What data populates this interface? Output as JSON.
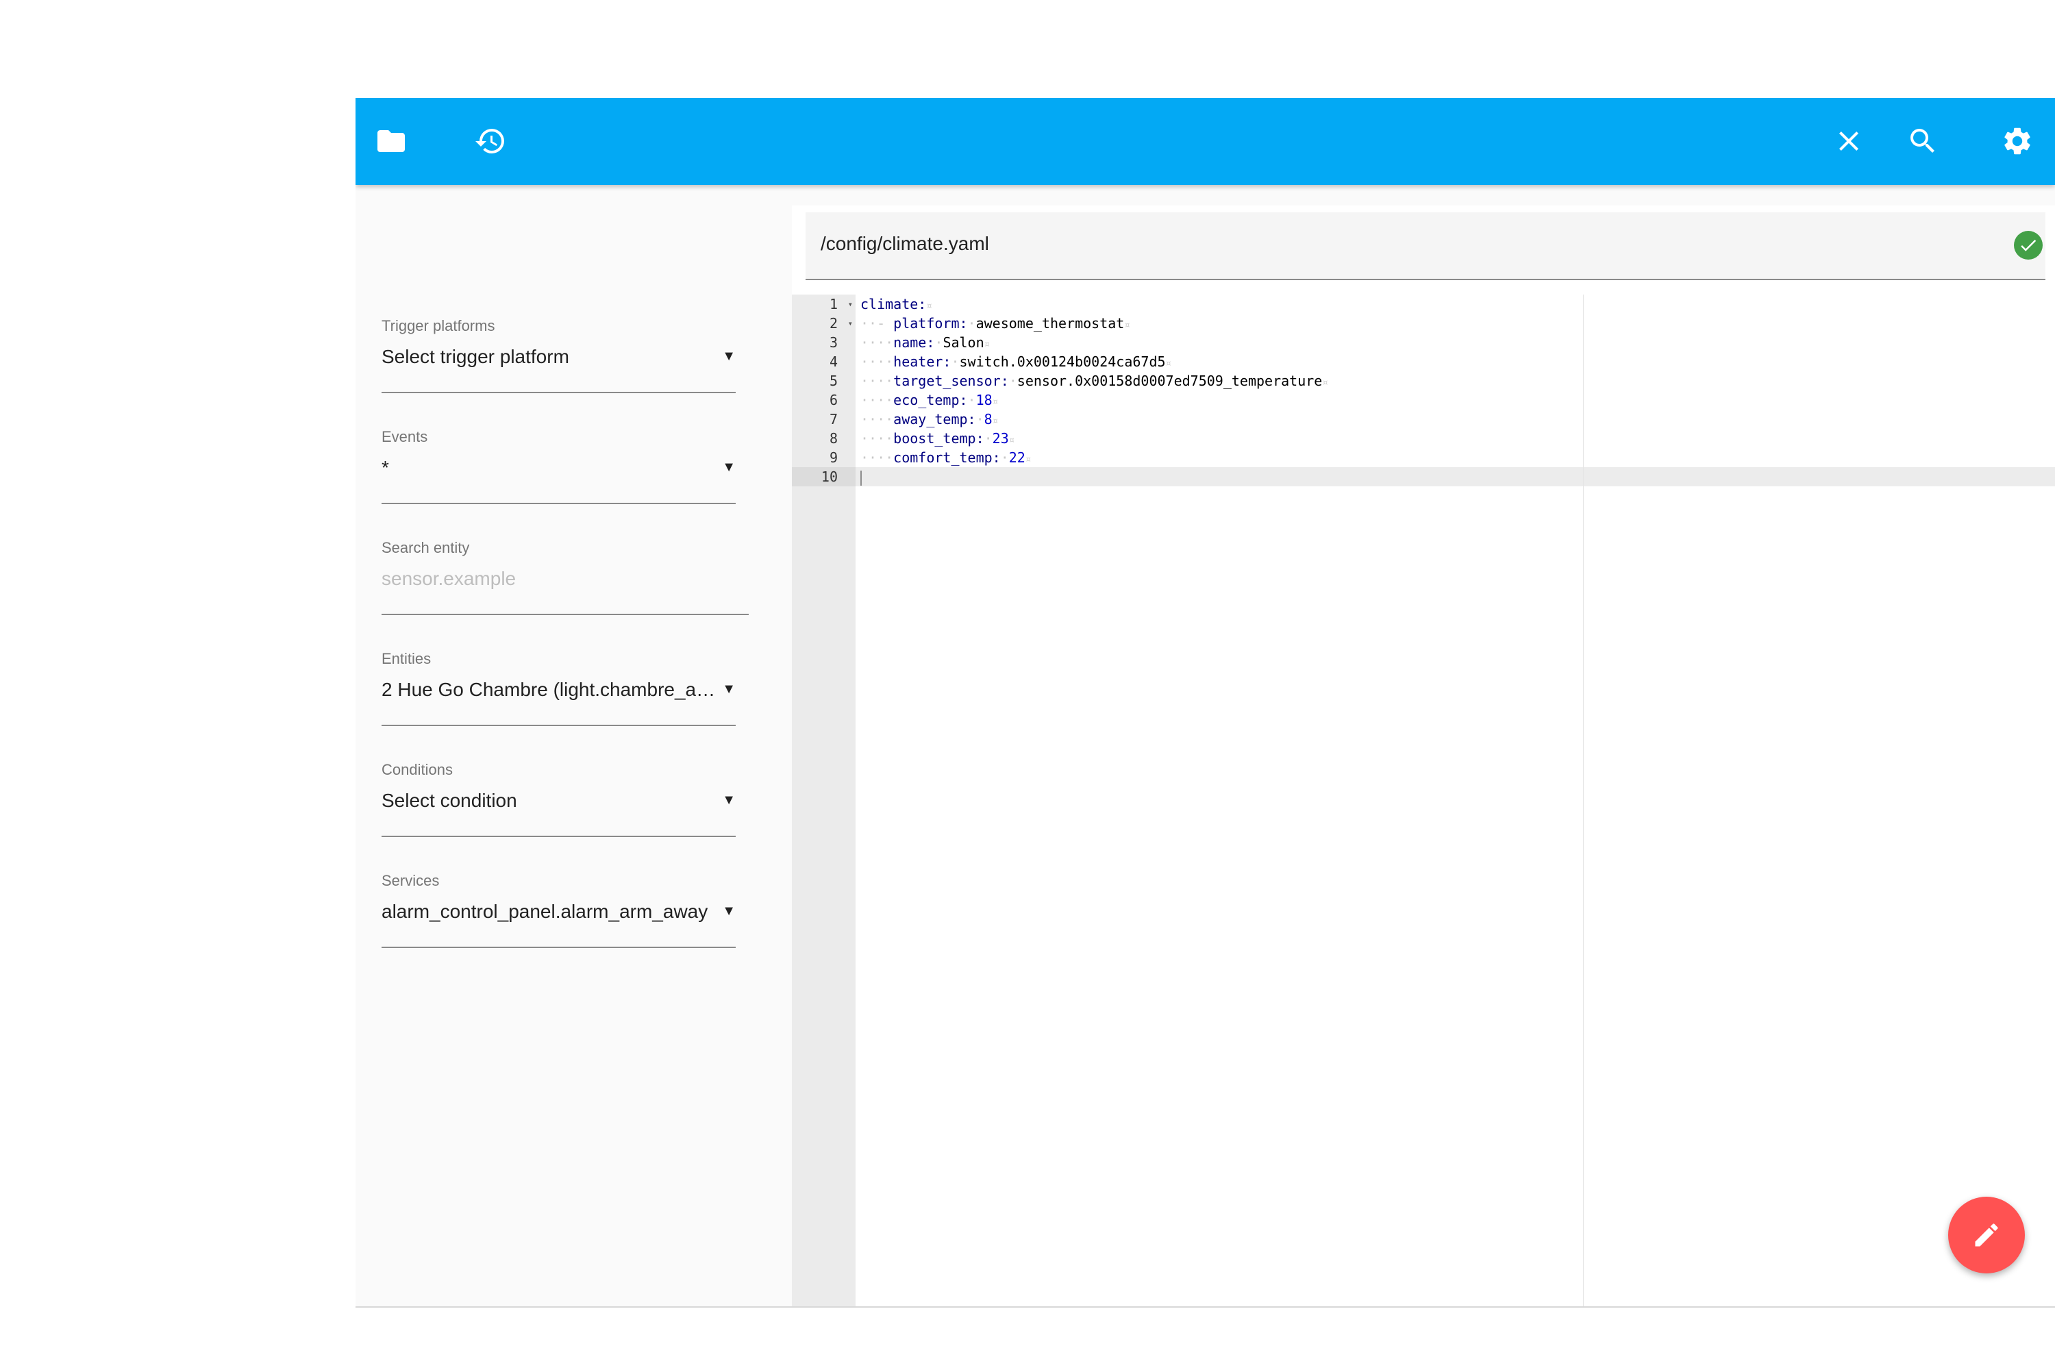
{
  "toolbar": {
    "background": "#03a9f4",
    "icons": [
      "folder-icon",
      "history-icon",
      "close-icon",
      "search-icon",
      "settings-icon"
    ]
  },
  "sidebar": {
    "trigger": {
      "label": "Trigger platforms",
      "value": "Select trigger platform"
    },
    "events": {
      "label": "Events",
      "value": "*"
    },
    "search": {
      "label": "Search entity",
      "placeholder": "sensor.example"
    },
    "entities": {
      "label": "Entities",
      "value": "2 Hue Go Chambre (light.chambre_a…"
    },
    "conditions": {
      "label": "Conditions",
      "value": "Select condition"
    },
    "services": {
      "label": "Services",
      "value": "alarm_control_panel.alarm_arm_away"
    }
  },
  "editor": {
    "file_path": "/config/climate.yaml",
    "valid_color": "#43a047",
    "line_numbers": [
      "1",
      "2",
      "3",
      "4",
      "5",
      "6",
      "7",
      "8",
      "9",
      "10"
    ],
    "lines": [
      {
        "indent": "",
        "key": "climate:",
        "value": "",
        "value_type": ""
      },
      {
        "indent": "··- ",
        "key": "platform:",
        "value": "awesome_thermostat",
        "value_type": "str"
      },
      {
        "indent": "····",
        "key": "name:",
        "value": "Salon",
        "value_type": "str"
      },
      {
        "indent": "····",
        "key": "heater:",
        "value": "switch.0x00124b0024ca67d5",
        "value_type": "str"
      },
      {
        "indent": "····",
        "key": "target_sensor:",
        "value": "sensor.0x00158d0007ed7509_temperature",
        "value_type": "str"
      },
      {
        "indent": "····",
        "key": "eco_temp:",
        "value": "18",
        "value_type": "num"
      },
      {
        "indent": "····",
        "key": "away_temp:",
        "value": "8",
        "value_type": "num"
      },
      {
        "indent": "····",
        "key": "boost_temp:",
        "value": "23",
        "value_type": "num"
      },
      {
        "indent": "····",
        "key": "comfort_temp:",
        "value": "22",
        "value_type": "num"
      },
      {
        "indent": "",
        "key": "",
        "value": "",
        "value_type": ""
      }
    ]
  },
  "fab": {
    "icon": "pencil-icon",
    "color": "#ff5252"
  }
}
